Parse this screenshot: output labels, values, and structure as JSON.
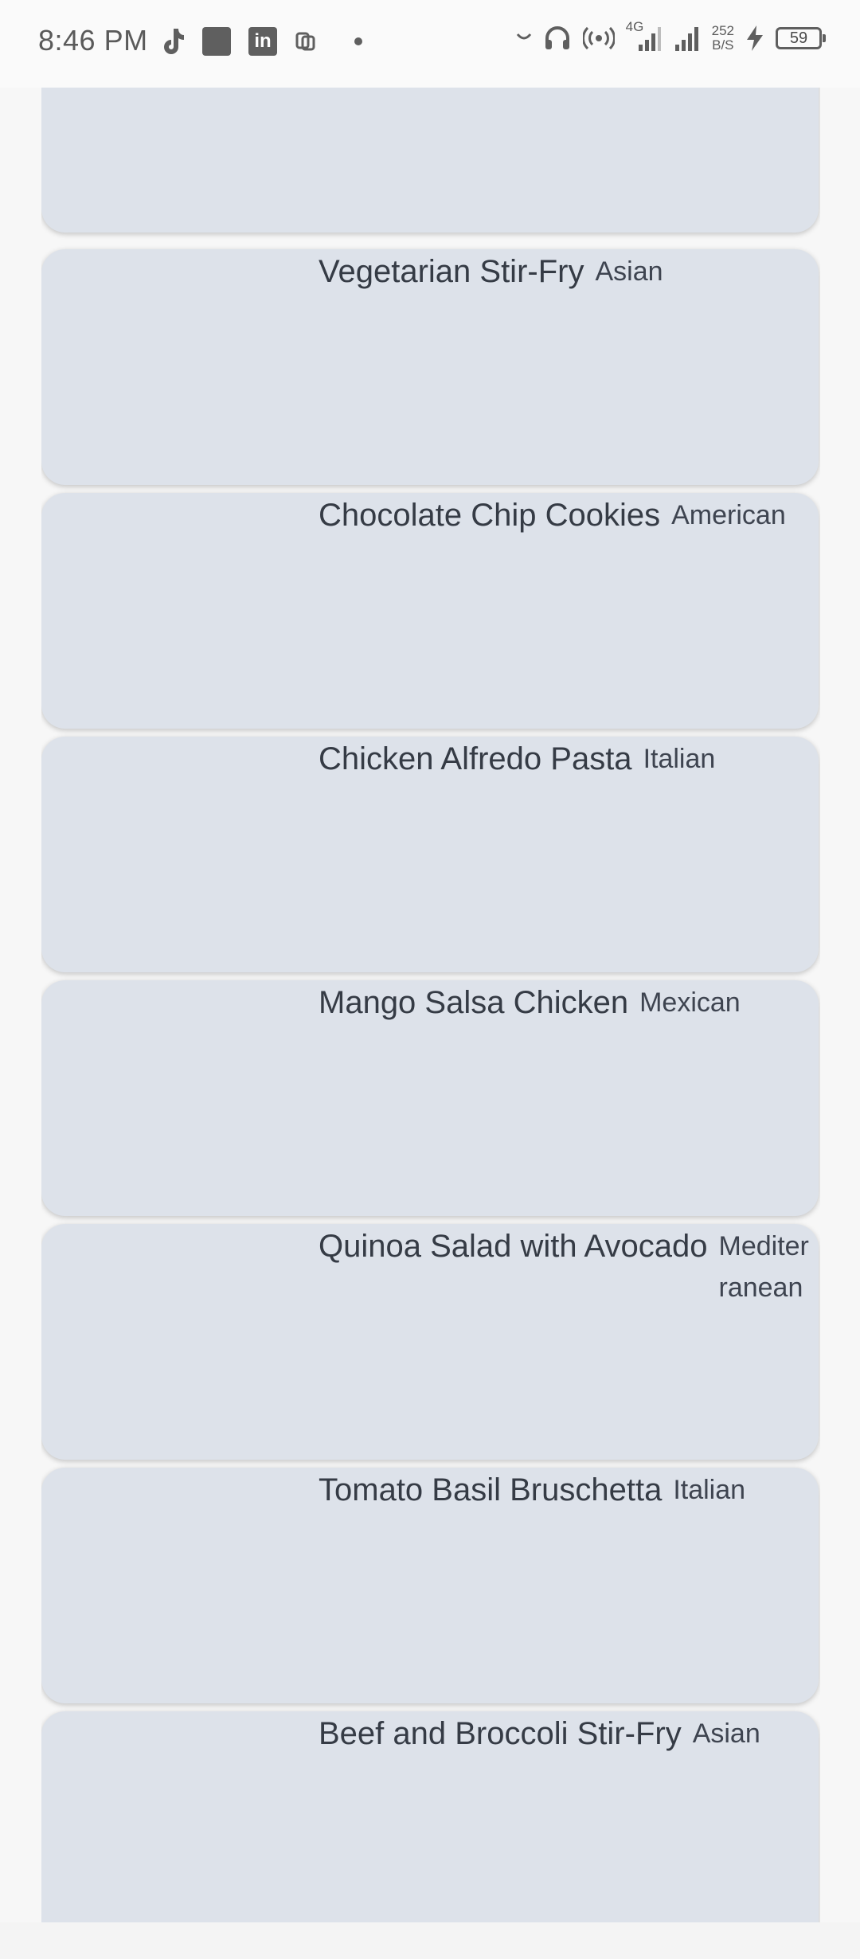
{
  "status_bar": {
    "time": "8:46 PM",
    "network_type": "4G",
    "speed_value": "252",
    "speed_unit": "B/S",
    "battery_level": "59",
    "left_icons": [
      "tiktok-icon",
      "app-square-icon",
      "linkedin-icon",
      "paypal-icon",
      "dot-icon"
    ],
    "right_icons": [
      "moon-icon",
      "headphones-icon",
      "hotspot-icon",
      "signal-4g-icon",
      "signal-icon",
      "network-speed",
      "charging-icon",
      "battery-icon"
    ]
  },
  "recipes": [
    {
      "name": "",
      "cuisine": ""
    },
    {
      "name": "Vegetarian Stir-Fry",
      "cuisine": "Asian"
    },
    {
      "name": "Chocolate Chip Cookies",
      "cuisine": "American"
    },
    {
      "name": "Chicken Alfredo Pasta",
      "cuisine": "Italian"
    },
    {
      "name": "Mango Salsa Chicken",
      "cuisine": "Mexican"
    },
    {
      "name": "Quinoa Salad with Avocado",
      "cuisine": "Mediterranean"
    },
    {
      "name": "Tomato Basil Bruschetta",
      "cuisine": "Italian"
    },
    {
      "name": "Beef and Broccoli Stir-Fry",
      "cuisine": "Asian"
    }
  ],
  "colors": {
    "card_background": "#dde2ea",
    "text": "#353b45",
    "page_background": "#f7f7f7"
  }
}
